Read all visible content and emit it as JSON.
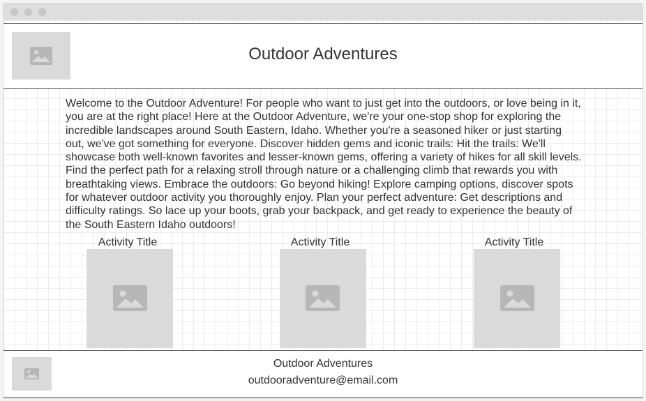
{
  "header": {
    "title": "Outdoor Adventures",
    "logo_icon": "image-placeholder-icon"
  },
  "intro": {
    "text": "Welcome to the Outdoor Adventure! For people who want to just get into the outdoors, or love being in it, you are at the right place! Here at the Outdoor Adventure, we're your one-stop shop for exploring the incredible landscapes around South Eastern, Idaho. Whether you're a seasoned hiker or just starting out, we've got something for everyone. Discover hidden gems and iconic trails: Hit the trails: We'll showcase both well-known favorites and lesser-known gems, offering a variety of hikes for all skill levels. Find the perfect path for a relaxing stroll through nature or a challenging climb that rewards you with breathtaking views. Embrace the outdoors: Go beyond hiking! Explore camping options, discover spots for whatever outdoor activity you thoroughly enjoy. Plan your perfect adventure: Get descriptions and difficulty ratings. So lace up your boots, grab your backpack, and get ready to experience the beauty of the South Eastern Idaho outdoors!"
  },
  "activities": [
    {
      "title": "Activity Title",
      "icon": "image-placeholder-icon"
    },
    {
      "title": "Activity Title",
      "icon": "image-placeholder-icon"
    },
    {
      "title": "Activity Title",
      "icon": "image-placeholder-icon"
    }
  ],
  "footer": {
    "name": "Outdoor Adventures",
    "email": "outdooradventure@email.com",
    "logo_icon": "image-placeholder-icon"
  },
  "colors": {
    "placeholder_bg": "#dadada",
    "placeholder_icon": "#b7b7b7",
    "border": "#555555",
    "text": "#333333"
  }
}
